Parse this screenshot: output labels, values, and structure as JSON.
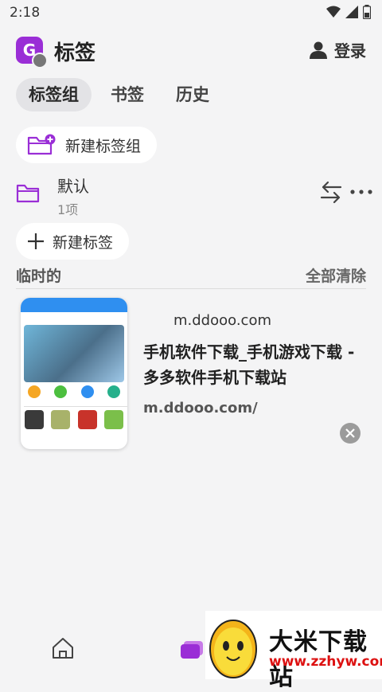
{
  "status_bar": {
    "time": "2:18"
  },
  "header": {
    "logo_letter": "G",
    "title": "标签",
    "login_label": "登录"
  },
  "tabs": [
    {
      "label": "标签组",
      "active": true
    },
    {
      "label": "书签",
      "active": false
    },
    {
      "label": "历史",
      "active": false
    }
  ],
  "new_group_label": "新建标签组",
  "group": {
    "name": "默认",
    "count": "1项"
  },
  "new_tab_label": "新建标签",
  "section": {
    "title": "临时的",
    "clear_all": "全部清除"
  },
  "tab_card": {
    "host": "m.ddooo.com",
    "title": "手机软件下载_手机游戏下载 - 多多软件手机下载站",
    "url": "m.ddooo.com/"
  },
  "watermark": {
    "title": "大米下载站",
    "url": "www.zzhyw.com"
  },
  "colors": {
    "accent": "#9a2ed6",
    "background": "#f4f4f5"
  }
}
